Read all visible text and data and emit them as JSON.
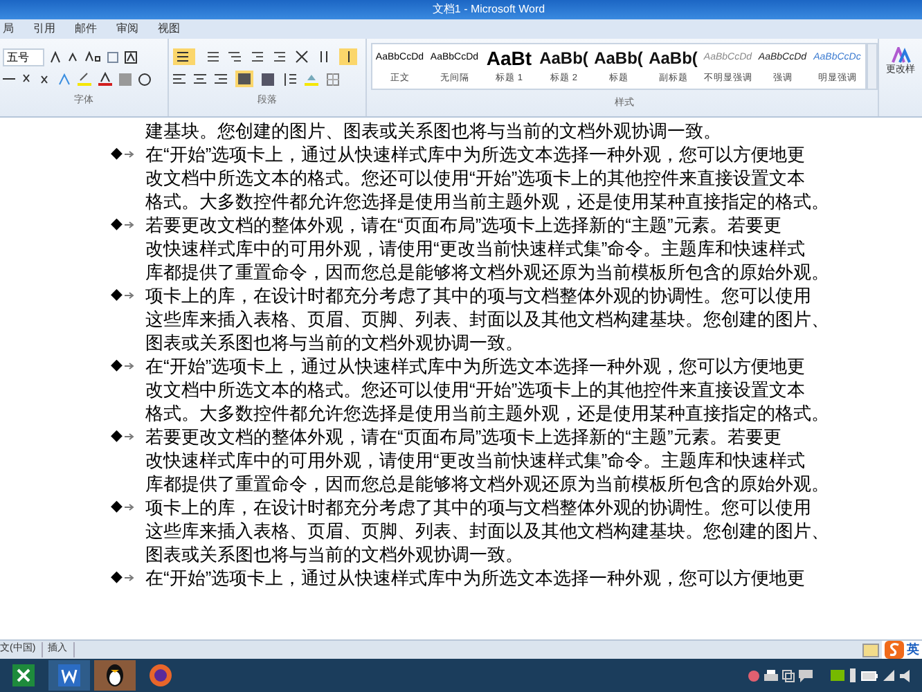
{
  "window": {
    "title": "文档1 - Microsoft Word"
  },
  "tabs": [
    {
      "label": "局"
    },
    {
      "label": "引用"
    },
    {
      "label": "邮件"
    },
    {
      "label": "审阅"
    },
    {
      "label": "视图"
    }
  ],
  "font_group": {
    "font_size": "五号",
    "label": "字体"
  },
  "paragraph_group": {
    "label": "段落"
  },
  "styles": {
    "label": "样式",
    "items": [
      {
        "preview": "AaBbCcDd",
        "name": "正文",
        "kind": "normal"
      },
      {
        "preview": "AaBbCcDd",
        "name": "无间隔",
        "kind": "normal"
      },
      {
        "preview": "AaBt",
        "name": "标题 1",
        "kind": "heading1"
      },
      {
        "preview": "AaBb(",
        "name": "标题 2",
        "kind": "heading2"
      },
      {
        "preview": "AaBb(",
        "name": "标题",
        "kind": "heading2"
      },
      {
        "preview": "AaBb(",
        "name": "副标题",
        "kind": "heading2"
      },
      {
        "preview": "AaBbCcDd",
        "name": "不明显强调",
        "kind": "subtle"
      },
      {
        "preview": "AaBbCcDd",
        "name": "强调",
        "kind": "emphasis"
      },
      {
        "preview": "AaBbCcDc",
        "name": "明显强调",
        "kind": "intense"
      }
    ]
  },
  "change_styles": {
    "label": "更改样"
  },
  "document": {
    "paragraphs": [
      {
        "lines": [
          "建基块。您创建的图片、图表或关系图也将与当前的文档外观协调一致。"
        ]
      },
      {
        "bullet": "◆",
        "lines": [
          "在“开始”选项卡上，通过从快速样式库中为所选文本选择一种外观，您可以方便地更",
          "改文档中所选文本的格式。您还可以使用“开始”选项卡上的其他控件来直接设置文本",
          "格式。大多数控件都允许您选择是使用当前主题外观，还是使用某种直接指定的格式。"
        ]
      },
      {
        "bullet": "◆",
        "lines": [
          "若要更改文档的整体外观，请在“页面布局”选项卡上选择新的“主题”元素。若要更",
          "改快速样式库中的可用外观，请使用“更改当前快速样式集”命令。主题库和快速样式",
          "库都提供了重置命令，因而您总是能够将文档外观还原为当前模板所包含的原始外观。"
        ]
      },
      {
        "bullet": "◆",
        "lines": [
          "项卡上的库，在设计时都充分考虑了其中的项与文档整体外观的协调性。您可以使用",
          "这些库来插入表格、页眉、页脚、列表、封面以及其他文档构建基块。您创建的图片、",
          "图表或关系图也将与当前的文档外观协调一致。"
        ]
      },
      {
        "bullet": "◆",
        "lines": [
          "在“开始”选项卡上，通过从快速样式库中为所选文本选择一种外观，您可以方便地更",
          "改文档中所选文本的格式。您还可以使用“开始”选项卡上的其他控件来直接设置文本",
          "格式。大多数控件都允许您选择是使用当前主题外观，还是使用某种直接指定的格式。"
        ]
      },
      {
        "bullet": "◆",
        "lines": [
          "若要更改文档的整体外观，请在“页面布局”选项卡上选择新的“主题”元素。若要更",
          "改快速样式库中的可用外观，请使用“更改当前快速样式集”命令。主题库和快速样式",
          "库都提供了重置命令，因而您总是能够将文档外观还原为当前模板所包含的原始外观。"
        ]
      },
      {
        "bullet": "◆",
        "lines": [
          "项卡上的库，在设计时都充分考虑了其中的项与文档整体外观的协调性。您可以使用",
          "这些库来插入表格、页眉、页脚、列表、封面以及其他文档构建基块。您创建的图片、",
          "图表或关系图也将与当前的文档外观协调一致。"
        ]
      },
      {
        "bullet": "◆",
        "lines": [
          "在“开始”选项卡上，通过从快速样式库中为所选文本选择一种外观，您可以方便地更"
        ]
      }
    ]
  },
  "status_bar": {
    "language": "文(中国)",
    "mode": "插入"
  },
  "ime": {
    "label": "英"
  }
}
